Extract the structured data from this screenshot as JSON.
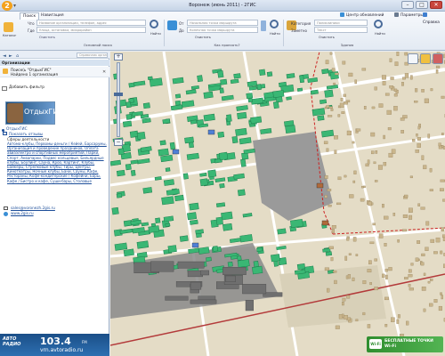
{
  "window": {
    "title": "Воронеж (июнь 2011) - 2ГИС",
    "logo_letter": "2",
    "minimize": "–",
    "maximize": "□",
    "close": "✕"
  },
  "ribbon": {
    "tabs": [
      "Поиск",
      "Навигация"
    ],
    "right_links": [
      "Центр обновлений",
      "Параметры",
      "Справка"
    ],
    "search": {
      "what_label": "Что",
      "what_placeholder": "Название организации, телефон, адрес",
      "where_label": "Где",
      "where_placeholder": "Улица, остановка, микрорайон",
      "find_label": "Найти",
      "clear_label": "Очистить",
      "catalog_label": "Каталог",
      "group_caption": "Основной поиск"
    },
    "route": {
      "from_label": "От",
      "from_placeholder": "Начальная точка маршрута",
      "to_label": "До",
      "to_placeholder": "Конечная точка маршрута",
      "find_label": "Найти",
      "clear_label": "Очистить",
      "group_caption": "Как проехать?"
    },
    "buildings": {
      "category_label": "Категория",
      "category_placeholder": "Поликлиники",
      "near_label": "Заметно",
      "near_placeholder": "Текст",
      "find_label": "Найти",
      "clear_label": "Очистить",
      "group_caption": "Здания"
    }
  },
  "left_panel": {
    "toolbar_field": "Справочник организаций",
    "header": "Организации",
    "query_title": "Поиск(ь \"ОтдыхГИС\"",
    "found_text": "Найдено 1 организация",
    "filter_label": "Добавить фильтр",
    "banner_text": "ОтдыхГИС",
    "org_name": "ОтдыхГИС",
    "show_link": "Показать отзывы",
    "activity_label": "Сферы деятельности",
    "activity_text": "Автомо-клубы, Первомы-деньги / Кейей, Барсарумы, Организация и проведение праздников, Оплата авиаэлектро и спортивных мероприятий, Парки, Спорт, Аквапарки, Подвес кольцевые, Бильярдные клубы, Боулинг, Сауна, Кроо, Картинг, Клубы, Байкеры, Стрелковые клубы, Тиры, Центры, Кинотеатры, Ночные клубы, Бани, Сауны, Кафе, Рестораны, Кофе-кондитерские / Кофейни, Бары, Кафе / Бистро и кафе, Суши-бары, Столовые",
    "email": "sales@voronezh.2gis.ru",
    "website": "www.2gis.ru"
  },
  "ads": {
    "left_brand": "АВТО РАДИО",
    "left_freq": "103.4",
    "left_fm": "FM",
    "left_url": "vrn.avtoradio.ru",
    "right_icon": "Wi-Fi",
    "right_text": "БЕСПЛАТНЫЕ ТОЧКИ Wi-Fi"
  },
  "map": {
    "zoom_in": "+",
    "zoom_out": "−",
    "colors": {
      "building": "#3ab774",
      "building_edge": "#1f7f4e",
      "ground": "#e4dcc6",
      "park": "#cdeac0",
      "road": "#ffffff",
      "industrial": "#8a8a8a",
      "railway": "#b33a3a",
      "district_border": "#cc2222",
      "poi_blue": "#4f7fd6",
      "poi_brown": "#b06a3a"
    }
  }
}
